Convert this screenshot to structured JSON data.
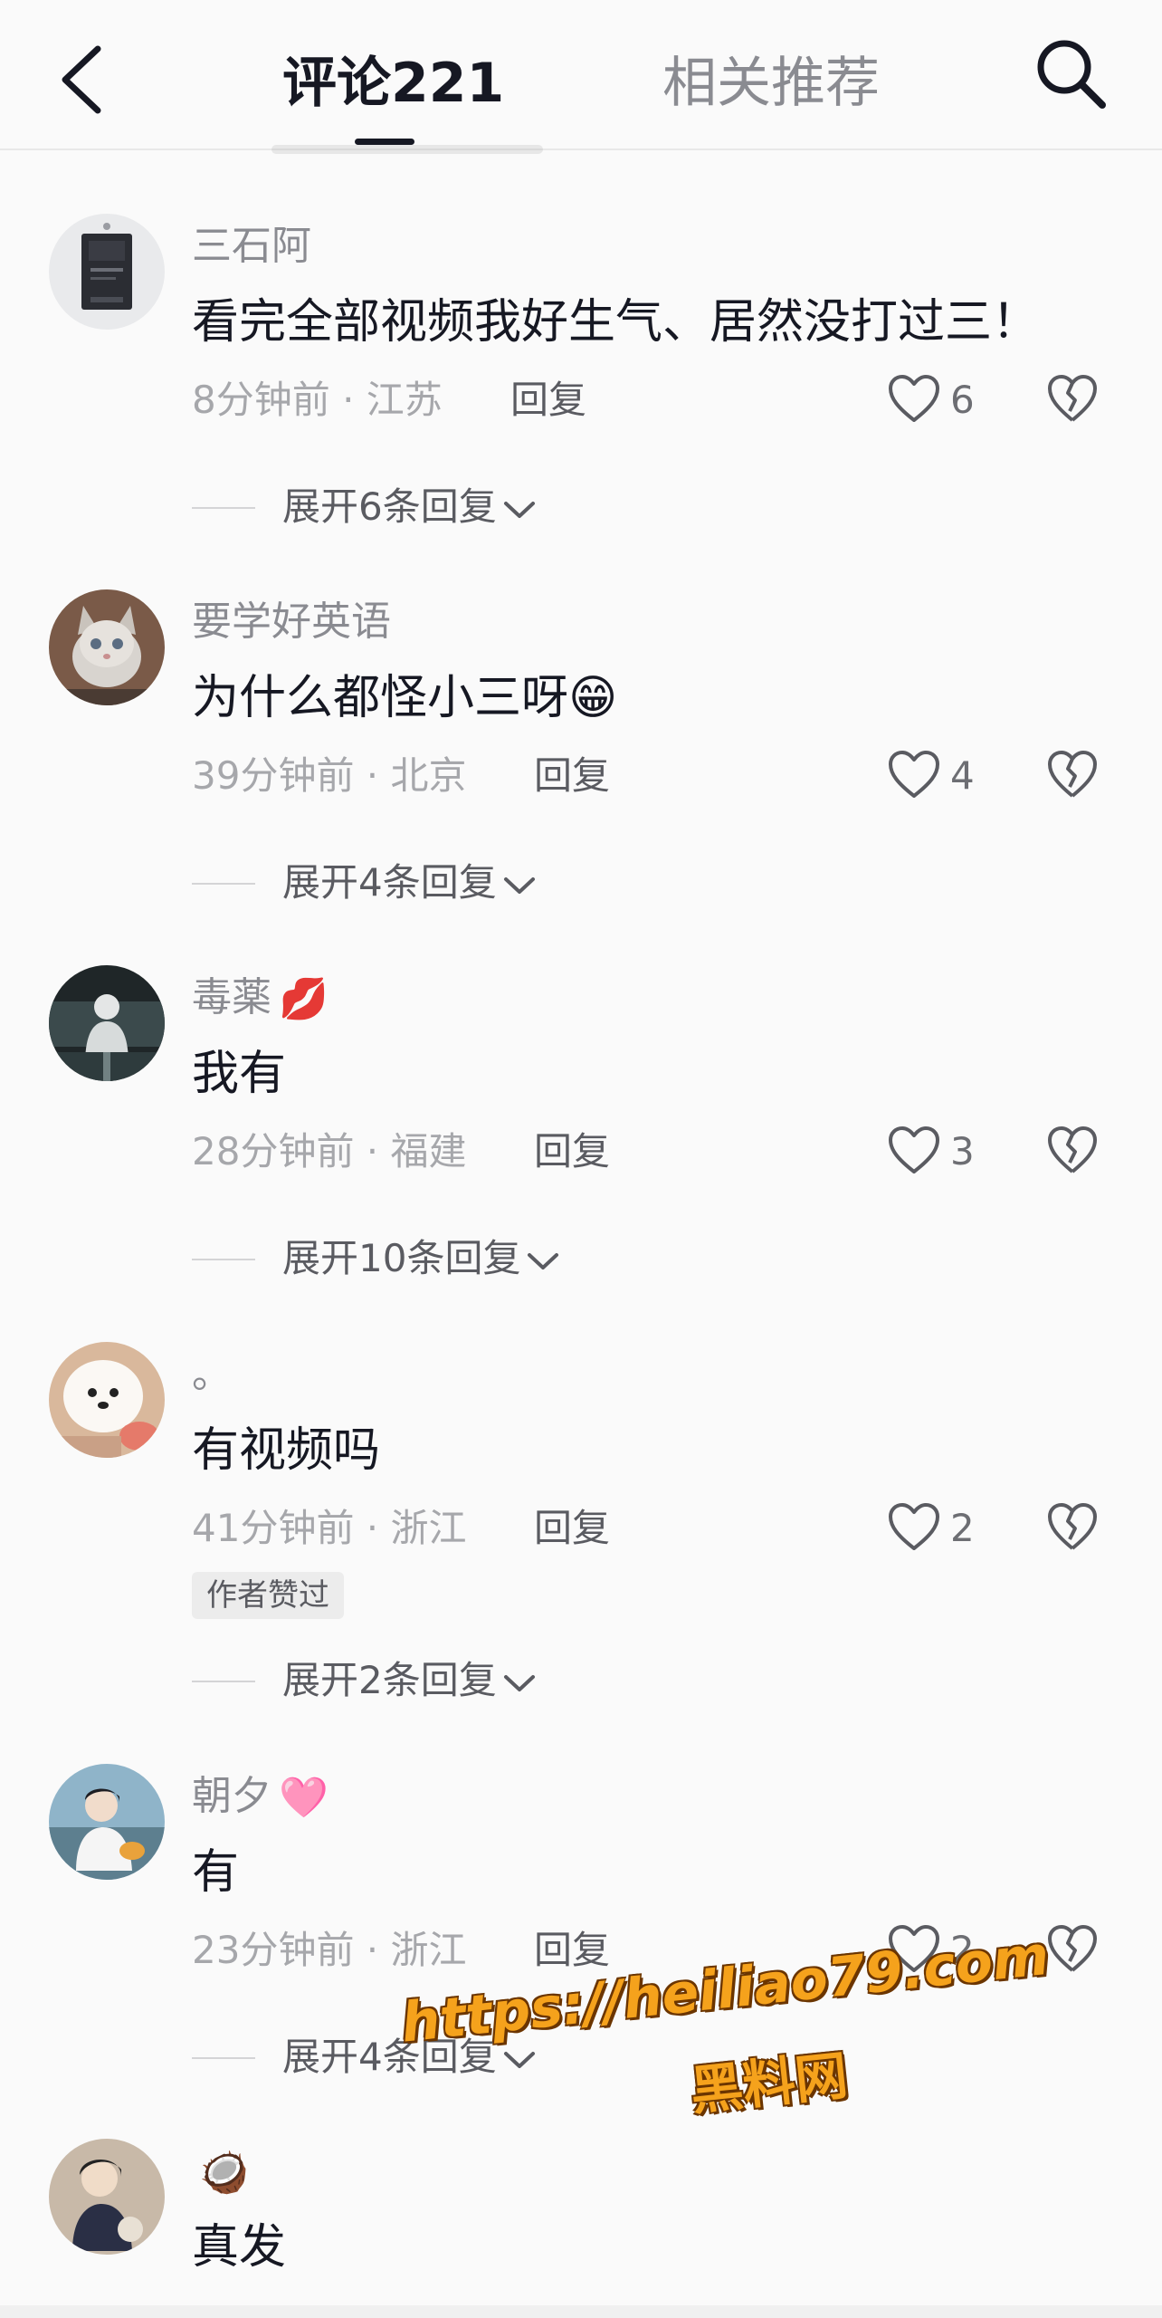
{
  "header": {
    "back_icon": "chevron-left-icon",
    "tab_comments": "评论221",
    "tab_related": "相关推荐",
    "search_icon": "search-icon"
  },
  "comments": [
    {
      "username": "三石阿",
      "username_emoji": "",
      "text": "看完全部视频我好生气、居然没打过三！",
      "time_location": "8分钟前 · 江苏",
      "reply": "回复",
      "likes": "6",
      "author_liked": "",
      "expand": "展开6条回复"
    },
    {
      "username": "要学好英语",
      "username_emoji": "",
      "text": "为什么都怪小三呀😁",
      "time_location": "39分钟前 · 北京",
      "reply": "回复",
      "likes": "4",
      "author_liked": "",
      "expand": "展开4条回复"
    },
    {
      "username": "毒薬",
      "username_emoji": "💋",
      "text": "我有",
      "time_location": "28分钟前 · 福建",
      "reply": "回复",
      "likes": "3",
      "author_liked": "",
      "expand": "展开10条回复"
    },
    {
      "username": "。",
      "username_emoji": "",
      "text": "有视频吗",
      "time_location": "41分钟前 · 浙江",
      "reply": "回复",
      "likes": "2",
      "author_liked": "作者赞过",
      "expand": "展开2条回复"
    },
    {
      "username": "朝夕",
      "username_emoji": "🩷",
      "text": "有",
      "time_location": "23分钟前 · 浙江",
      "reply": "回复",
      "likes": "2",
      "author_liked": "",
      "expand": "展开4条回复"
    },
    {
      "username": "",
      "username_emoji": "🥥",
      "text": "真发",
      "time_location": "",
      "reply": "",
      "likes": "",
      "author_liked": "",
      "expand": ""
    }
  ],
  "watermark": {
    "url": "https://heiliao79.com",
    "name": "黑料网"
  },
  "colors": {
    "primary_text": "#161823",
    "secondary_text": "#8a8b91",
    "background": "#fafafa",
    "watermark": "#f5a21c"
  }
}
